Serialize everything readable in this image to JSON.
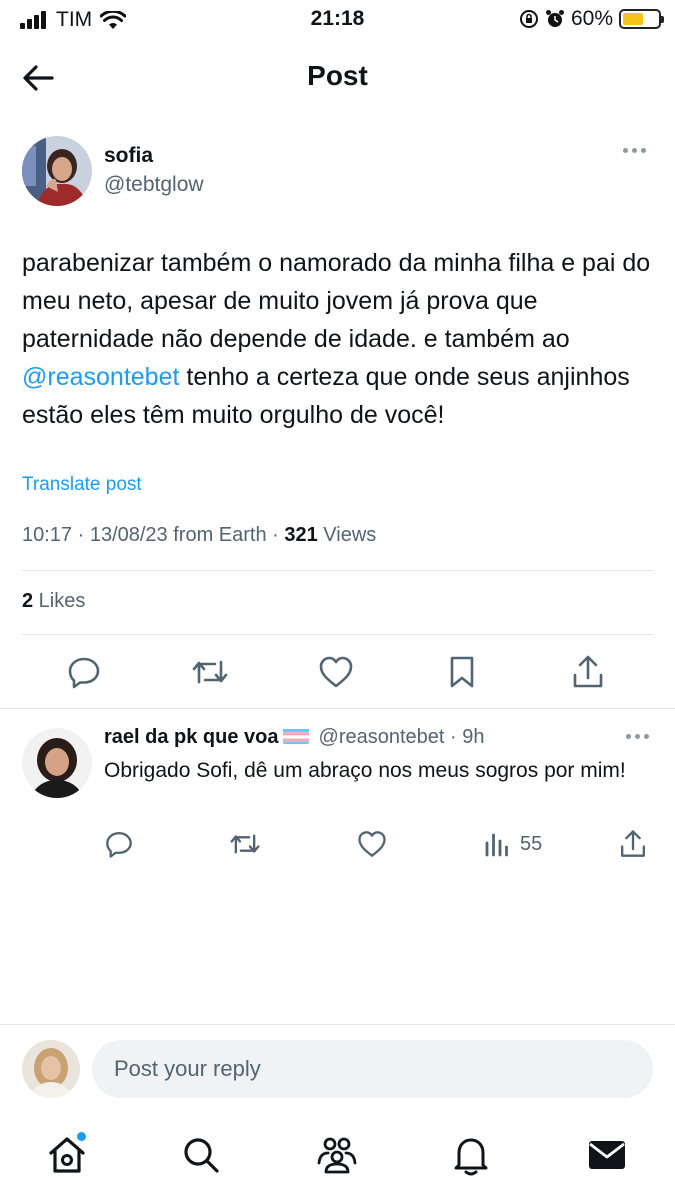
{
  "status_bar": {
    "carrier": "TIM",
    "time": "21:18",
    "battery": "60%",
    "battery_level": 0.6,
    "battery_color": "#f5c518"
  },
  "header": {
    "title": "Post",
    "back_icon": "arrow-left-icon"
  },
  "post": {
    "author_name": "sofia",
    "author_handle": "@tebtglow",
    "text_before_mention": "parabenizar também o namorado da minha filha e pai do meu neto, apesar de muito jovem já prova que paternidade não depende de idade. e também ao ",
    "mention": "@reasontebet",
    "text_after_mention": " tenho a certeza que onde seus anjinhos estão eles têm muito orgulho de você!",
    "translate_label": "Translate post",
    "timestamp": "10:17 · 13/08/23 from Earth · ",
    "views_count": "321",
    "views_label": " Views",
    "likes_count": "2",
    "likes_label": " Likes",
    "actions": [
      "reply-icon",
      "repost-icon",
      "like-icon",
      "bookmark-icon",
      "share-icon"
    ]
  },
  "reply": {
    "name": "rael da pk que voa",
    "handle": "@reasontebet · 9h",
    "text": "Obrigado Sofi, dê um abraço nos meus sogros por mim!",
    "views": "55",
    "actions": [
      "reply-icon",
      "repost-icon",
      "like-icon",
      "views-icon",
      "share-icon"
    ]
  },
  "composer": {
    "placeholder": "Post your reply"
  },
  "nav": [
    "home-icon",
    "search-icon",
    "communities-icon",
    "notifications-icon",
    "messages-icon"
  ],
  "colors": {
    "accent": "#1d9bf0",
    "text": "#0f1419",
    "secondary": "#536471"
  }
}
